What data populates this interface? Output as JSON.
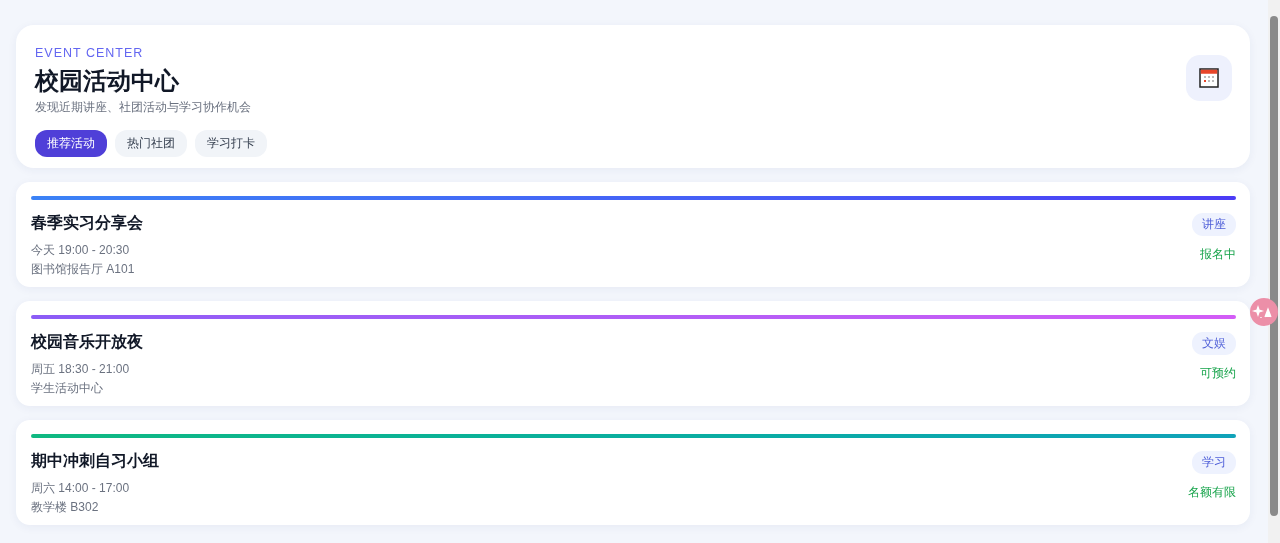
{
  "header": {
    "eyebrow": "EVENT CENTER",
    "title": "校园活动中心",
    "subtitle": "发现近期讲座、社团活动与学习协作机会",
    "tabs": [
      {
        "label": "推荐活动",
        "selected": true
      },
      {
        "label": "热门社团",
        "selected": false
      },
      {
        "label": "学习打卡",
        "selected": false
      }
    ]
  },
  "events": [
    {
      "title": "春季实习分享会",
      "time": "今天 19:00 - 20:30",
      "place": "图书馆报告厅 A101",
      "tag": "讲座",
      "status": "报名中",
      "color": "#3b82f6"
    },
    {
      "title": "校园音乐开放夜",
      "time": "周五 18:30 - 21:00",
      "place": "学生活动中心",
      "tag": "文娱",
      "status": "可预约",
      "color": "#8b5cf6"
    },
    {
      "title": "期中冲刺自习小组",
      "time": "周六 14:00 - 17:00",
      "place": "教学楼 B302",
      "tag": "学习",
      "status": "名额有限",
      "color": "#10b981"
    }
  ]
}
